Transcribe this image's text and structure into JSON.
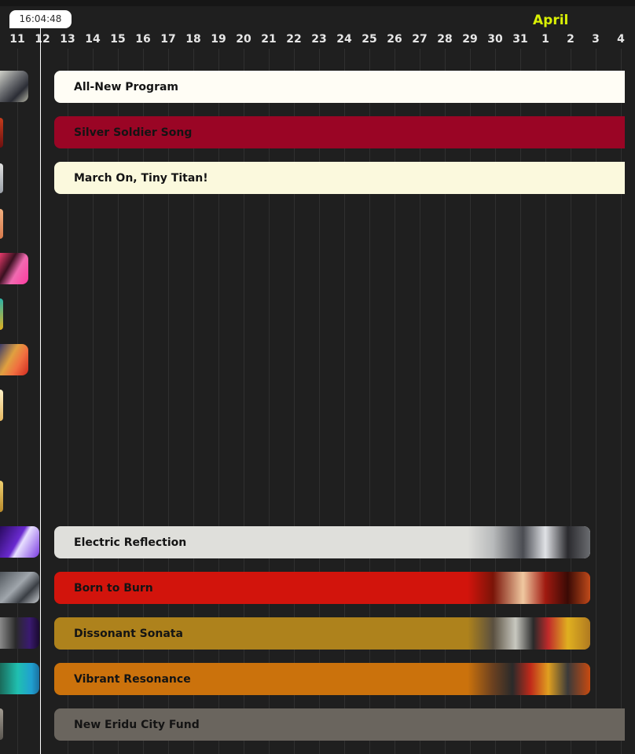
{
  "clock": {
    "time": "16:04:48"
  },
  "timeline": {
    "month": "April",
    "days": [
      "11",
      "12",
      "13",
      "14",
      "15",
      "16",
      "17",
      "18",
      "19",
      "20",
      "21",
      "22",
      "23",
      "24",
      "25",
      "26",
      "27",
      "28",
      "29",
      "30",
      "31",
      "1",
      "2",
      "3",
      "4"
    ]
  },
  "events": [
    {
      "name": "All-New Program",
      "color": "#fffdf5",
      "has_banner": false
    },
    {
      "name": "Silver Soldier Song",
      "color": "#9a0525",
      "has_banner": false
    },
    {
      "name": "March On, Tiny Titan!",
      "color": "#fbf9dd",
      "has_banner": false
    },
    {
      "name": "Electric Reflection",
      "color": "#dfdfdb",
      "has_banner": true
    },
    {
      "name": "Born to Burn",
      "color": "#d2140c",
      "has_banner": true
    },
    {
      "name": "Dissonant Sonata",
      "color": "#ae821c",
      "has_banner": true
    },
    {
      "name": "Vibrant Resonance",
      "color": "#cb720c",
      "has_banner": true
    },
    {
      "name": "New Eridu City Fund",
      "color": "#6a655e",
      "has_banner": false
    }
  ],
  "sidebar_thumbnails": [
    {
      "name": "event-thumbnail-1"
    },
    {
      "name": "event-thumbnail-2"
    },
    {
      "name": "event-thumbnail-3"
    },
    {
      "name": "event-thumbnail-4"
    },
    {
      "name": "event-thumbnail-5"
    },
    {
      "name": "event-thumbnail-6"
    },
    {
      "name": "event-thumbnail-7"
    },
    {
      "name": "event-thumbnail-8"
    },
    {
      "name": "event-thumbnail-9"
    },
    {
      "name": "event-thumbnail-10"
    },
    {
      "name": "event-thumbnail-11"
    },
    {
      "name": "event-thumbnail-12"
    },
    {
      "name": "event-thumbnail-13"
    },
    {
      "name": "event-thumbnail-14"
    }
  ]
}
